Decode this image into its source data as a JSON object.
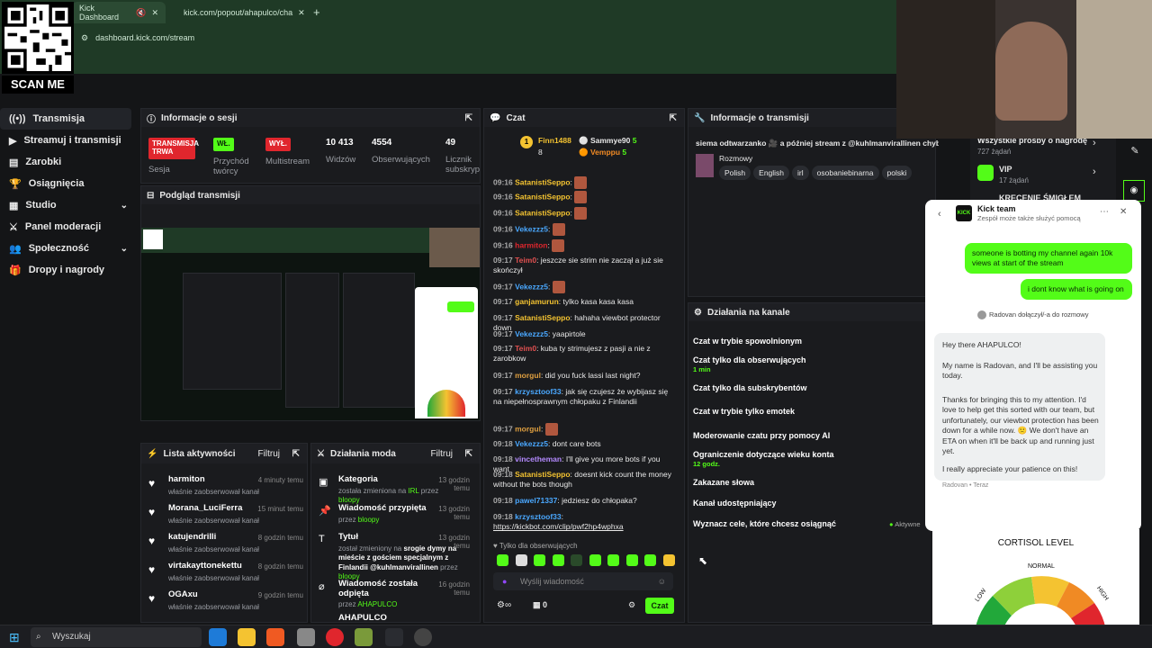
{
  "browser": {
    "tab1": "Kick Dashboard",
    "tab2": "kick.com/popout/ahapulco/cha",
    "url": "dashboard.kick.com/stream",
    "scan_me": "SCAN ME"
  },
  "sidebar": {
    "items": [
      {
        "label": "Transmisja"
      },
      {
        "label": "Streamuj i transmisji"
      },
      {
        "label": "Zarobki"
      },
      {
        "label": "Osiągnięcia"
      },
      {
        "label": "Studio"
      },
      {
        "label": "Panel moderacji"
      },
      {
        "label": "Społeczność"
      },
      {
        "label": "Dropy i nagrody"
      }
    ]
  },
  "session": {
    "title": "Informacje o sesji",
    "badge1": "TRANSMISJA TRWA",
    "badge1_label": "Sesja",
    "badge2": "WŁ.",
    "badge2_label": "Przychód twórcy",
    "badge3": "WYŁ.",
    "badge3_label": "Multistream",
    "views": "10 413",
    "views_label": "Widzów",
    "followers": "4554",
    "followers_label": "Obserwujących",
    "subs": "49",
    "subs_label": "Licznik subskryp"
  },
  "preview": {
    "title": "Podgląd transmisji"
  },
  "activity": {
    "title": "Lista aktywności",
    "filter": "Filtruj",
    "rows": [
      {
        "name": "harmiton",
        "desc": "właśnie zaobserwował kanał",
        "time": "4 minuty temu"
      },
      {
        "name": "Morana_LuciFerra",
        "desc": "właśnie zaobserwował kanał",
        "time": "15 minut temu"
      },
      {
        "name": "katujendrilli",
        "desc": "właśnie zaobserwował kanał",
        "time": "8 godzin temu"
      },
      {
        "name": "virtakayttonekettu",
        "desc": "właśnie zaobserwował kanał",
        "time": "8 godzin temu"
      },
      {
        "name": "OGAxu",
        "desc": "właśnie zaobserwował kanał",
        "time": "9 godzin temu"
      }
    ]
  },
  "modactions": {
    "title": "Działania moda",
    "filter": "Filtruj",
    "rows": [
      {
        "name": "Kategoria",
        "desc_a": "została zmieniona na",
        "desc_b": "IRL",
        "desc_c": "przez",
        "desc_d": "bloopy",
        "time": "13 godzin temu"
      },
      {
        "name": "Wiadomość przypięta",
        "desc_a": "przez",
        "desc_d": "bloopy",
        "time": "13 godzin temu"
      },
      {
        "name": "Tytuł",
        "desc_a": "został zmieniony na",
        "desc_b": "srogie dymy na mieście z gościem specjalnym z Finlandii @kuhlmanvirallinen",
        "desc_c": "przez",
        "desc_d": "bloopy",
        "time": "13 godzin temu"
      },
      {
        "name": "Wiadomość została odpięta",
        "desc_a": "przez",
        "desc_d": "AHAPULCO",
        "time": "16 godzin temu"
      },
      {
        "name": "AHAPULCO"
      }
    ]
  },
  "chat": {
    "title": "Czat",
    "top1": "Finn1488",
    "top1_val": "8",
    "top2": "Sammye90",
    "top2_val": "5",
    "top3": "Vemppu",
    "top3_val": "5",
    "messages": [
      {
        "t": "09:16",
        "u": "SatanistiSeppo",
        "m": ""
      },
      {
        "t": "09:16",
        "u": "SatanistiSeppo",
        "m": ""
      },
      {
        "t": "09:16",
        "u": "SatanistiSeppo",
        "m": ""
      },
      {
        "t": "09:16",
        "u": "Vekezzz5",
        "m": ""
      },
      {
        "t": "09:16",
        "u": "harmiton",
        "m": ""
      },
      {
        "t": "09:17",
        "u": "Teim0",
        "m": "jeszcze sie strim nie zaczął a już sie skończył"
      },
      {
        "t": "09:17",
        "u": "Vekezzz5",
        "m": ""
      },
      {
        "t": "09:17",
        "u": "ganjamurun",
        "m": "tylko kasa kasa kasa"
      },
      {
        "t": "09:17",
        "u": "SatanistiSeppo",
        "m": "hahaha viewbot protector down"
      },
      {
        "t": "09:17",
        "u": "Vekezzz5",
        "m": "yaapirtole"
      },
      {
        "t": "09:17",
        "u": "Teim0",
        "m": "kuba ty strimujesz z pasji a nie z zarobkow"
      },
      {
        "t": "09:17",
        "u": "morgul",
        "m": "did you fuck lassi last night?"
      },
      {
        "t": "09:17",
        "u": "krzysztoof33",
        "m": "jak się czujesz że wybijasz się na niepełnosprawnym chłopaku z Finlandii"
      },
      {
        "t": "09:17",
        "u": "morgul",
        "m": ""
      },
      {
        "t": "09:18",
        "u": "Vekezzz5",
        "m": "dont care bots"
      },
      {
        "t": "09:18",
        "u": "vincetheman",
        "m": "I'll give you more bots if you want"
      },
      {
        "t": "09:18",
        "u": "SatanistiSeppo",
        "m": "doesnt kick count the money without the bots though"
      },
      {
        "t": "09:18",
        "u": "pawel71337",
        "m": "jedziesz do chłopaka?"
      },
      {
        "t": "09:18",
        "u": "krzysztoof33",
        "m": "https://kickbot.com/clip/pwf2hp4wphxa"
      }
    ],
    "followers_only": "Tylko dla obserwujących",
    "input_placeholder": "Wyślij wiadomość",
    "points": "0",
    "send_label": "Czat"
  },
  "stream_info": {
    "title": "Informacje o transmisji",
    "stream_title": "siema odtwarzanko 🎥 a później stream z @kuhlmanvirallinen chyba",
    "category": "Rozmowy",
    "tags": [
      "Polish",
      "English",
      "irl",
      "osobaniebinarna",
      "polski"
    ]
  },
  "channel_actions": {
    "title": "Działania na kanale",
    "rows": [
      {
        "label": "Czat w trybie spowolnionym",
        "sub": ""
      },
      {
        "label": "Czat tylko dla obserwujących",
        "sub": "1 min"
      },
      {
        "label": "Czat tylko dla subskrybentów",
        "sub": ""
      },
      {
        "label": "Czat w trybie tylko emotek",
        "sub": ""
      },
      {
        "label": "Moderowanie czatu przy pomocy AI",
        "sub": ""
      },
      {
        "label": "Ograniczenie dotyczące wieku konta",
        "sub": "12 godz."
      },
      {
        "label": "Zakazane słowa",
        "sub": ""
      },
      {
        "label": "Kanał udostępniający",
        "sub": ""
      },
      {
        "label": "Wyznacz cele, które chcesz osiągnąć",
        "sub": ""
      }
    ],
    "active_label": "Aktywne"
  },
  "requests": {
    "all": "Wszystkie prośby o nagrodę",
    "all_count": "727 żądań",
    "vip": "VIP",
    "vip_count": "17 żądań",
    "third": "KRECENIE ŚMIGŁEM"
  },
  "support": {
    "name": "Kick team",
    "subtitle": "Zespół może także służyć pomocą",
    "my_msg1": "someone is botting my channel again 10k views at start of the stream",
    "my_msg2": "i dont know what is going on",
    "joined": "Radovan dołączył/-a do rozmowy",
    "reply1": "Hey there AHAPULCO!",
    "reply2": "My name is Radovan, and I'll be assisting you today.",
    "reply3": "Thanks for bringing this to my attention. I'd love to help get this sorted with our team, but unfortunately, our viewbot protection has been down for a while now. 🙁 We don't have an ETA on when it'll be back up and running just yet.",
    "reply4": "I really appreciate your patience on this!",
    "footer": "Radovan • Teraz"
  },
  "cortisol": {
    "title": "CORTISOL LEVEL",
    "low": "LOW",
    "normal": "NORMAL",
    "high": "HIGH"
  },
  "taskbar": {
    "search": "Wyszukaj"
  },
  "colors": {
    "accent": "#53fc18",
    "panel": "#1a1b1e",
    "red": "#e0262d"
  }
}
